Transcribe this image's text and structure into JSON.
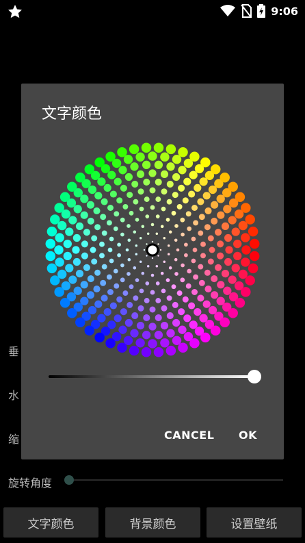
{
  "status_bar": {
    "time": "9:06",
    "icons": [
      "star-icon",
      "wifi-icon",
      "no-sim-icon",
      "battery-charging-icon"
    ]
  },
  "background": {
    "labels": [
      "垂",
      "水",
      "缩"
    ],
    "rotation_label": "旋转角度",
    "buttons": [
      "文字颜色",
      "背景颜色",
      "设置壁纸"
    ]
  },
  "dialog": {
    "title": "文字颜色",
    "lightness": 1.0,
    "cancel_label": "CANCEL",
    "ok_label": "OK"
  }
}
